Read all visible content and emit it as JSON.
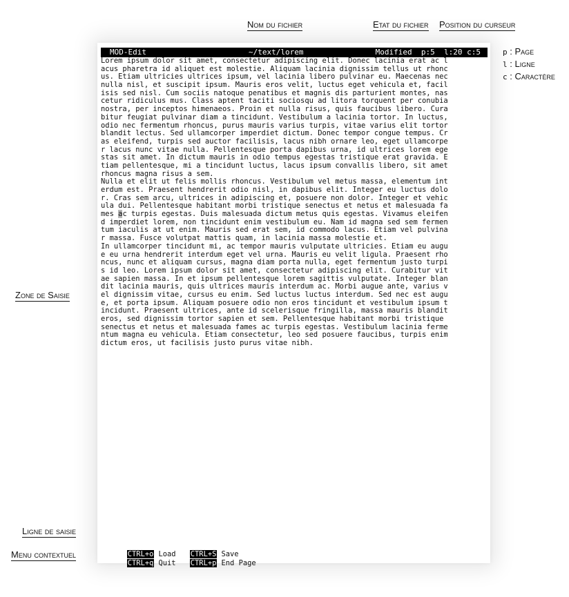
{
  "annotations": {
    "filename": "Nom du fichier",
    "file_state": "Etat du fichier",
    "cursor_position": "Position du curseur",
    "input_zone": "Zone de Saisie",
    "input_line": "Ligne de saisie",
    "context_menu": "Menu contextuel"
  },
  "legend": [
    {
      "key": "p",
      "sep": " : ",
      "label": "Page"
    },
    {
      "key": "l",
      "sep": " : ",
      "label": "Ligne"
    },
    {
      "key": "c",
      "sep": " : ",
      "label": "Caractère"
    }
  ],
  "statusbar": {
    "app_name": "MOD-Edit",
    "file_path": "~/text/lorem",
    "state": "Modified  p:5  l:20 c:5"
  },
  "editor": {
    "lines": [
      "Lorem ipsum dolor sit amet, consectetur adipiscing elit. Donec lacinia erat ac l",
      "acus pharetra id aliquet est molestie. Aliquam lacinia dignissim tellus ut rhonc",
      "us. Etiam ultricies ultrices ipsum, vel lacinia libero pulvinar eu. Maecenas nec",
      "nulla nisl, et suscipit ipsum. Mauris eros velit, luctus eget vehicula et, facil",
      "isis sed nisl. Cum sociis natoque penatibus et magnis dis parturient montes, nas",
      "cetur ridiculus mus. Class aptent taciti sociosqu ad litora torquent per conubia",
      "nostra, per inceptos himenaeos. Proin et nulla risus, quis faucibus libero. Cura",
      "bitur feugiat pulvinar diam a tincidunt. Vestibulum a lacinia tortor. In luctus,",
      "odio nec fermentum rhoncus, purus mauris varius turpis, vitae varius elit tortor",
      "blandit lectus. Sed ullamcorper imperdiet dictum. Donec tempor congue tempus. Cr",
      "as eleifend, turpis sed auctor facilisis, lacus nibh ornare leo, eget ullamcorpe",
      "r lacus nunc vitae nulla. Pellentesque porta dapibus urna, id ultrices lorem ege",
      "stas sit amet. In dictum mauris in odio tempus egestas tristique erat gravida. E",
      "tiam pellentesque, mi a tincidunt luctus, lacus ipsum convallis libero, sit amet",
      "rhoncus magna risus a sem.",
      "Nulla et elit ut felis mollis rhoncus. Vestibulum vel metus massa, elementum int",
      "erdum est. Praesent hendrerit odio nisl, in dapibus elit. Integer eu luctus dolo",
      "r. Cras sem arcu, ultrices in adipiscing et, posuere non dolor. Integer et vehic",
      "ula dui. Pellentesque habitant morbi tristique senectus et netus et malesuada fa",
      "mes ac turpis egestas. Duis malesuada dictum metus quis egestas. Vivamus eleifen",
      "d imperdiet lorem, non tincidunt enim vestibulum eu. Nam id magna sed sem fermen",
      "tum iaculis at ut enim. Mauris sed erat sem, id commodo lacus. Etiam vel pulvina",
      "r massa. Fusce volutpat mattis quam, in lacinia massa molestie et.",
      "In ullamcorper tincidunt mi, ac tempor mauris vulputate ultricies. Etiam eu augu",
      "e eu urna hendrerit interdum eget vel urna. Mauris eu velit ligula. Praesent rho",
      "ncus, nunc et aliquam cursus, magna diam porta nulla, eget fermentum justo turpi",
      "s id leo. Lorem ipsum dolor sit amet, consectetur adipiscing elit. Curabitur vit",
      "ae sapien massa. In et ipsum pellentesque lorem sagittis vulputate. Integer blan",
      "dit lacinia mauris, quis ultrices mauris interdum ac. Morbi augue ante, varius v",
      "el dignissim vitae, cursus eu enim. Sed luctus luctus interdum. Sed nec est augu",
      "e, et porta ipsum. Aliquam posuere odio non eros tincidunt et vestibulum ipsum t",
      "incidunt. Praesent ultrices, ante id scelerisque fringilla, massa mauris blandit",
      "eros, sed dignissim tortor sapien et sem. Pellentesque habitant morbi tristique",
      "senectus et netus et malesuada fames ac turpis egestas. Vestibulum lacinia ferme",
      "ntum magna eu vehicula. Etiam consectetur, leo sed posuere faucibus, turpis enim",
      "dictum eros, ut facilisis justo purus vitae nibh."
    ],
    "cursor": {
      "line": 20,
      "char": 5
    }
  },
  "menu": [
    {
      "key": "CTRL+o",
      "label": "Load"
    },
    {
      "key": "CTRL+S",
      "label": "Save"
    },
    {
      "key": "CTRL+q",
      "label": "Quit"
    },
    {
      "key": "CTRL+p",
      "label": "End Page"
    }
  ]
}
